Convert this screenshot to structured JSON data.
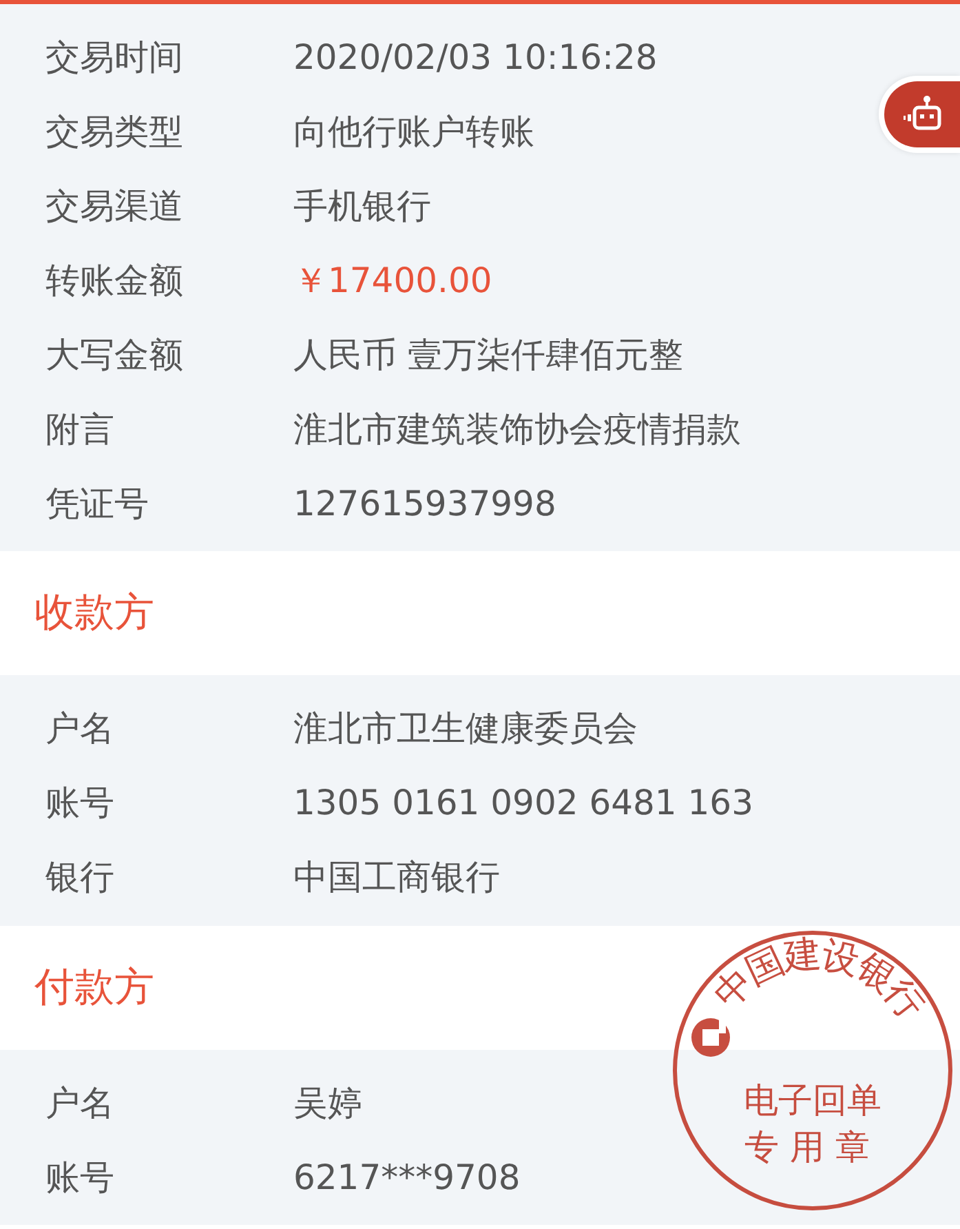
{
  "details": [
    {
      "label": "交易时间",
      "value": "2020/02/03 10:16:28",
      "kind": "text"
    },
    {
      "label": "交易类型",
      "value": "向他行账户转账",
      "kind": "text"
    },
    {
      "label": "交易渠道",
      "value": "手机银行",
      "kind": "text"
    },
    {
      "label": "转账金额",
      "value": "￥17400.00",
      "kind": "amount"
    },
    {
      "label": "大写金额",
      "value": "人民币 壹万柒仟肆佰元整",
      "kind": "text"
    },
    {
      "label": "附言",
      "value": "淮北市建筑装饰协会疫情捐款",
      "kind": "text"
    },
    {
      "label": "凭证号",
      "value": "127615937998",
      "kind": "text"
    }
  ],
  "payee": {
    "title": "收款方",
    "rows": [
      {
        "label": "户名",
        "value": "淮北市卫生健康委员会"
      },
      {
        "label": "账号",
        "value": "1305 0161 0902 6481 163"
      },
      {
        "label": "银行",
        "value": "中国工商银行"
      }
    ]
  },
  "payer": {
    "title": "付款方",
    "rows": [
      {
        "label": "户名",
        "value": "吴婷"
      },
      {
        "label": "账号",
        "value": "6217***9708"
      }
    ]
  },
  "stamp": {
    "arc_text": "中国建设银行",
    "lines": [
      "电子回单",
      "专用章"
    ]
  }
}
